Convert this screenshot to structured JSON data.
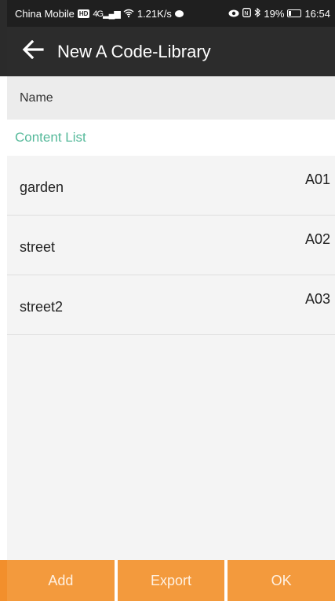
{
  "status_bar": {
    "carrier": "China Mobile",
    "network": "HD",
    "signal": "4G",
    "speed": "1.21K/s",
    "battery": "19%",
    "time": "16:54"
  },
  "app_bar": {
    "title": "New A Code-Library"
  },
  "name_row": {
    "label": "Name"
  },
  "content_list": {
    "header": "Content List",
    "items": [
      {
        "name": "garden",
        "code": "A01"
      },
      {
        "name": "street",
        "code": "A02"
      },
      {
        "name": "street2",
        "code": "A03"
      }
    ]
  },
  "bottom_bar": {
    "add_label": "Add",
    "export_label": "Export",
    "ok_label": "OK"
  },
  "colors": {
    "accent": "#f39a3d",
    "section_header": "#55b99a",
    "app_bar": "#2c2c2c"
  }
}
